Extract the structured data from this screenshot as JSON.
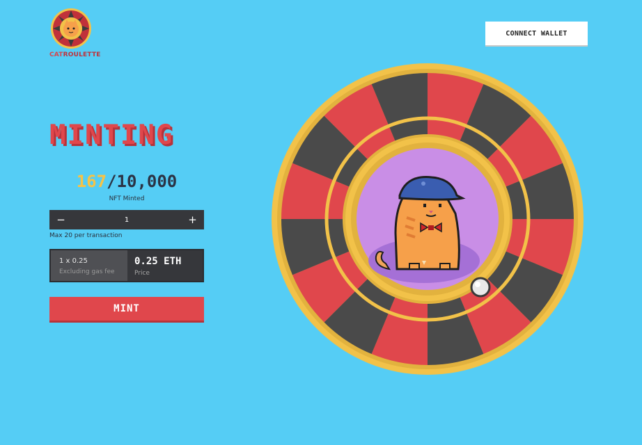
{
  "brand": {
    "name_part1": "CAT",
    "name_part2": "ROULETTE"
  },
  "header": {
    "connect_label": "CONNECT WALLET"
  },
  "mint_panel": {
    "title": "MINTING",
    "minted_count": "167",
    "separator": "/",
    "total_supply": "10,000",
    "minted_label": "NFT Minted",
    "decrement_symbol": "−",
    "quantity": "1",
    "increment_symbol": "+",
    "max_note": "Max 20 per transaction",
    "calc": "1 x 0.25",
    "gas_note": "Excluding gas fee",
    "price_value": "0.25 ETH",
    "price_label": "Price",
    "mint_label": "MINT"
  },
  "colors": {
    "background": "#55cdf5",
    "accent_red": "#e0474c",
    "gold": "#f6c347",
    "dark_panel": "#36373b",
    "wheel_dark": "#4a4a4a",
    "wheel_gold": "#f2c249",
    "center_purple": "#c98ee6"
  },
  "icons": {
    "logo": "roulette-cat-logo",
    "wheel": "roulette-wheel",
    "cat": "pixel-cat",
    "ball": "roulette-ball"
  }
}
